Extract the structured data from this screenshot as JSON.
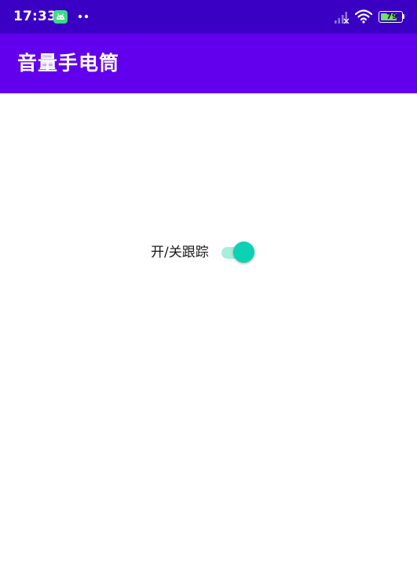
{
  "status_bar": {
    "time": "17:33",
    "battery_level": "79",
    "battery_fraction": 0.79,
    "icons": [
      "android-app-icon",
      "more-dots-icon",
      "signal-icon",
      "wifi-icon",
      "battery-icon"
    ]
  },
  "app_bar": {
    "title": "音量手电筒"
  },
  "main": {
    "toggle": {
      "label": "开/关跟踪",
      "checked": true
    }
  },
  "colors": {
    "status_bar": "#3a00c4",
    "app_bar": "#6200ee",
    "switch_thumb": "#0bd2b4",
    "switch_track": "#a9eddd",
    "background": "#ffffff"
  }
}
